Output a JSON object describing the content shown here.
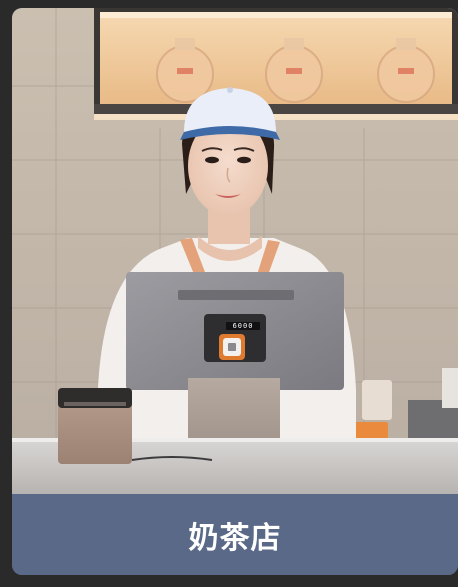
{
  "card": {
    "caption": "奶茶店",
    "image_subject": "barista-at-pos-terminal"
  },
  "pos_display": {
    "reading": "6000"
  },
  "colors": {
    "page_background": "#2a2a2b",
    "caption_bar": "#5a6987",
    "caption_text": "#ffffff",
    "cap": "#e9eef8",
    "cap_visor": "#3f6aa8",
    "terminal_body": "#8d8d93",
    "scanner_accent": "#e07a2f"
  }
}
